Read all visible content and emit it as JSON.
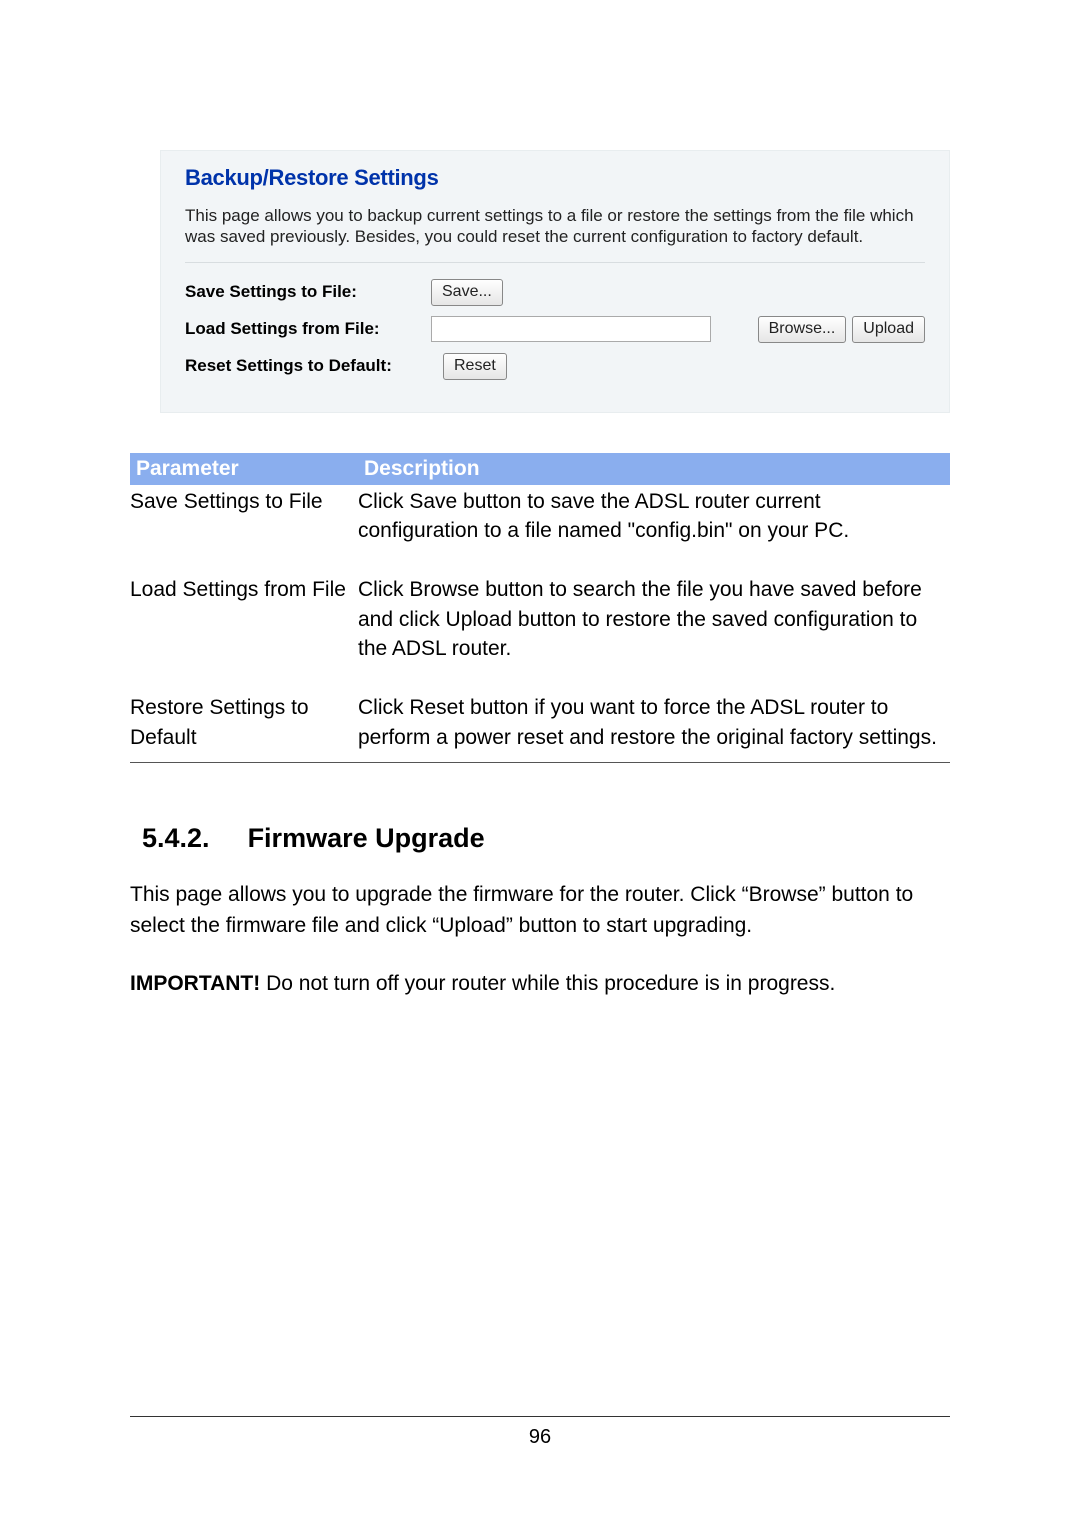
{
  "panel": {
    "title": "Backup/Restore Settings",
    "intro": "This page allows you to backup current settings to a file or restore the settings from the file which was saved previously. Besides, you could reset the current configuration to factory default.",
    "save_label": "Save Settings to File:",
    "save_btn": "Save...",
    "load_label": "Load Settings from File:",
    "browse_btn": "Browse...",
    "upload_btn": "Upload",
    "reset_label": "Reset Settings to Default:",
    "reset_btn": "Reset"
  },
  "table": {
    "headers": {
      "param": "Parameter",
      "desc": "Description"
    },
    "rows": [
      {
        "param": "Save Settings to File",
        "desc": "Click Save button to save the ADSL router current configuration to a file named \"config.bin\" on your PC."
      },
      {
        "param": "Load Settings from File",
        "desc": "Click Browse button to search the file you have saved before and click Upload button to restore the saved configuration to the ADSL router."
      },
      {
        "param": "Restore Settings to Default",
        "desc": "Click Reset button if you want to force the ADSL router to perform a power reset and restore the original factory settings."
      }
    ]
  },
  "section": {
    "number": "5.4.2.",
    "title": "Firmware Upgrade",
    "para1": "This page allows you to upgrade the firmware for the router. Click “Browse” button to select the firmware file and click “Upload” button to start upgrading.",
    "important_label": "IMPORTANT!",
    "important_rest": " Do not turn off your router while this procedure is in progress."
  },
  "page_number": "96"
}
